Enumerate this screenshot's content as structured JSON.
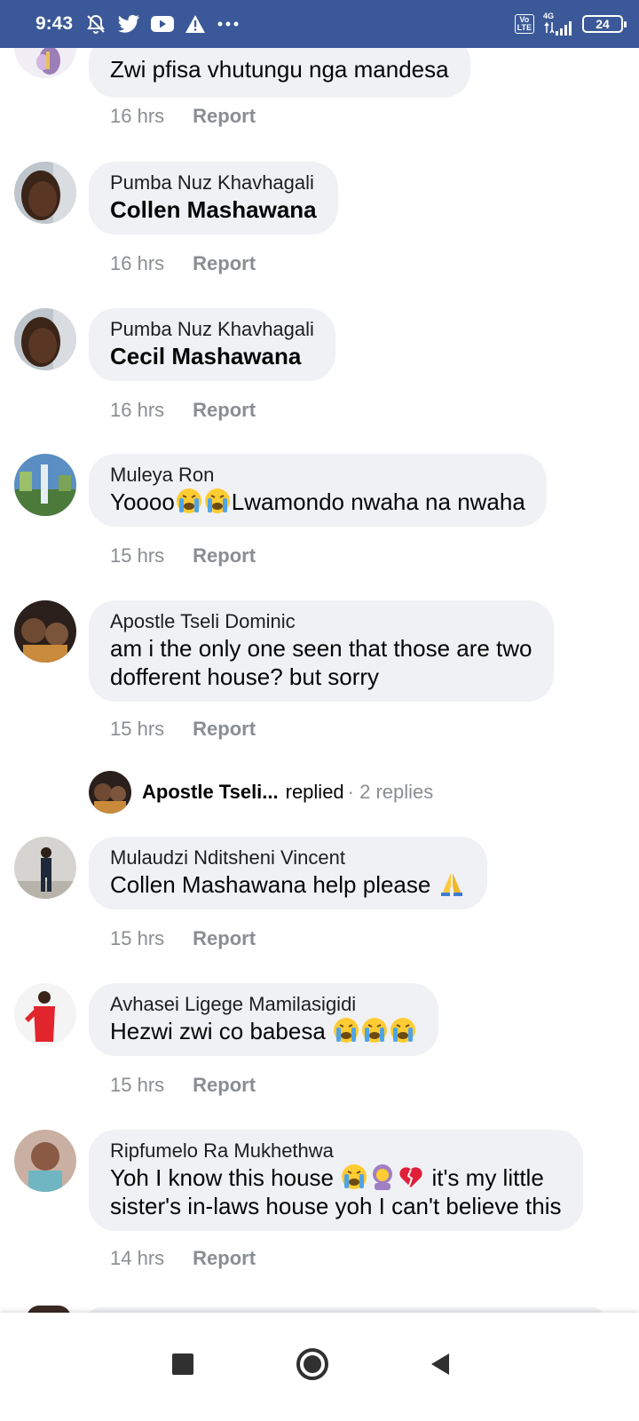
{
  "status_bar": {
    "time": "9:43",
    "icons": [
      "mute-bell-icon",
      "twitter-icon",
      "youtube-icon",
      "warning-icon",
      "more-dots-icon"
    ],
    "volte_line1": "Vo",
    "volte_line2": "LTE",
    "network": "4G",
    "battery": "24"
  },
  "comments": [
    {
      "author": "",
      "text": "Zwi pfisa vhutungu nga mandesa",
      "time": "16 hrs",
      "action": "Report"
    },
    {
      "author": "Pumba Nuz Khavhagali",
      "text": "Collen Mashawana",
      "time": "16 hrs",
      "action": "Report"
    },
    {
      "author": "Pumba Nuz Khavhagali",
      "text": "Cecil Mashawana",
      "time": "16 hrs",
      "action": "Report"
    },
    {
      "author": "Muleya Ron",
      "text_before": "Yoooo",
      "text_after": "Lwamondo nwaha na nwaha",
      "time": "15 hrs",
      "action": "Report"
    },
    {
      "author": "Apostle Tseli Dominic",
      "text_line1": "am i the only one seen that those are two",
      "text_line2": "dofferent house? but sorry",
      "time": "15 hrs",
      "action": "Report"
    },
    {
      "author": "Mulaudzi Nditsheni Vincent",
      "text": "Collen Mashawana help please",
      "time": "15 hrs",
      "action": "Report"
    },
    {
      "author": "Avhasei Ligege Mamilasigidi",
      "text": "Hezwi zwi co babesa",
      "time": "15 hrs",
      "action": "Report"
    },
    {
      "author": "Ripfumelo Ra Mukhethwa",
      "text_before": "Yoh I know this house",
      "text_after": "it's my little",
      "text_line2": "sister's in-laws house yoh I can't believe this",
      "time": "14 hrs",
      "action": "Report"
    }
  ],
  "replies": {
    "name": "Apostle Tseli...",
    "verb": "replied",
    "count": "· 2 replies"
  },
  "colors": {
    "status_bar": "#3b5998",
    "bubble": "#eff1f4",
    "meta": "#8a8d91"
  }
}
